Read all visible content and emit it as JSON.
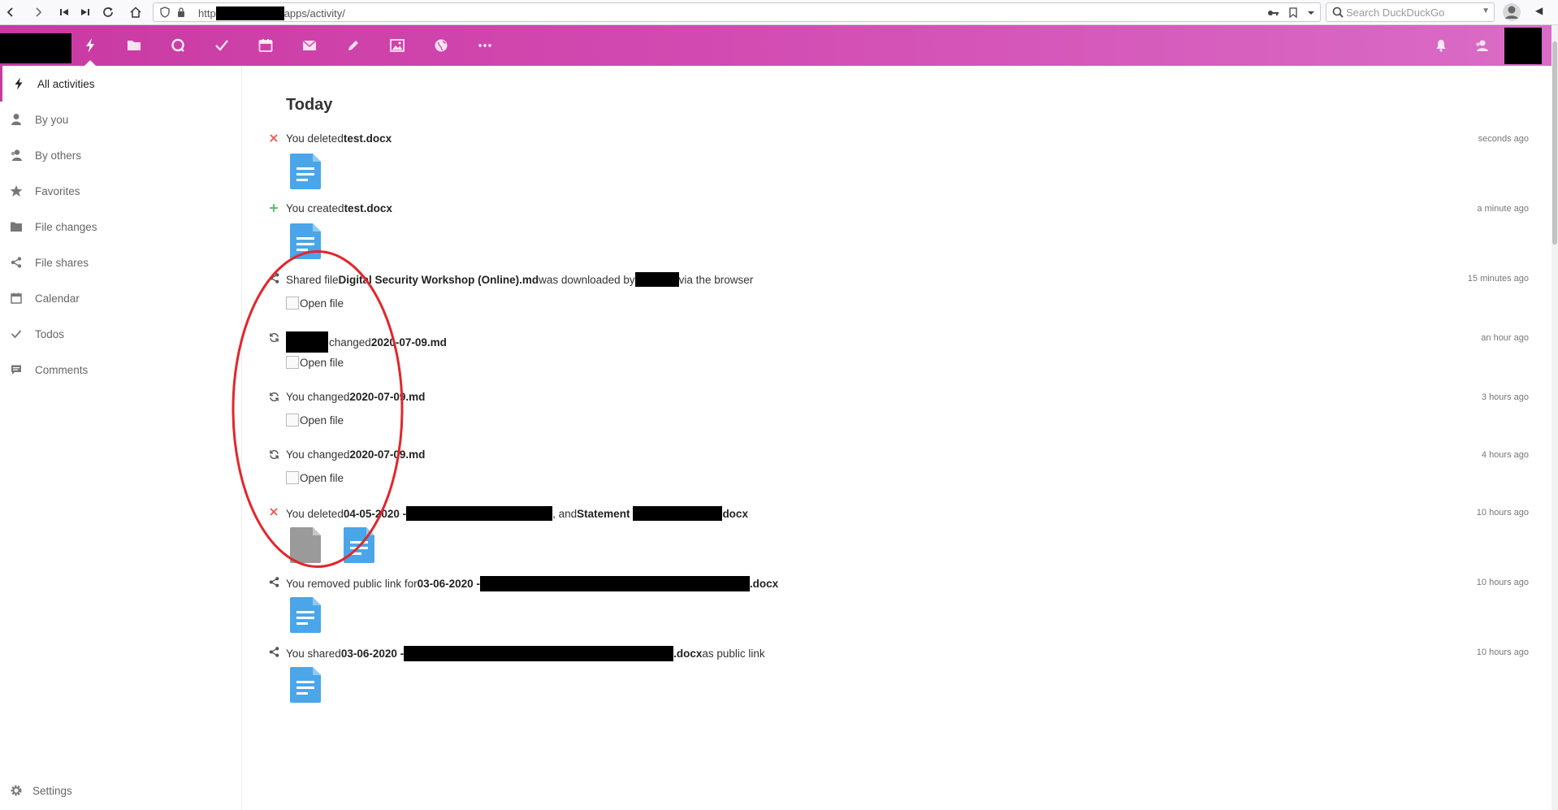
{
  "browser": {
    "url_prefix": "http",
    "url_suffix": "apps/activity/",
    "search_placeholder": "Search DuckDuckGo"
  },
  "header": {
    "apps": [
      {
        "name": "activity",
        "icon": "bolt-icon",
        "active": true
      },
      {
        "name": "files",
        "icon": "folder-icon"
      },
      {
        "name": "talk",
        "icon": "talk-icon"
      },
      {
        "name": "tasks",
        "icon": "check-icon"
      },
      {
        "name": "calendar",
        "icon": "calendar-icon"
      },
      {
        "name": "mail",
        "icon": "mail-icon"
      },
      {
        "name": "notes",
        "icon": "pencil-icon"
      },
      {
        "name": "photos",
        "icon": "image-icon"
      },
      {
        "name": "maps",
        "icon": "globe-icon"
      },
      {
        "name": "more",
        "icon": "more-icon"
      }
    ]
  },
  "sidebar": {
    "items": [
      {
        "label": "All activities",
        "icon": "bolt-icon",
        "active": true
      },
      {
        "label": "By you",
        "icon": "user-icon"
      },
      {
        "label": "By others",
        "icon": "users-icon"
      },
      {
        "label": "Favorites",
        "icon": "star-icon"
      },
      {
        "label": "File changes",
        "icon": "folder-icon"
      },
      {
        "label": "File shares",
        "icon": "share-icon"
      },
      {
        "label": "Calendar",
        "icon": "calendar-icon"
      },
      {
        "label": "Todos",
        "icon": "check-icon"
      },
      {
        "label": "Comments",
        "icon": "comment-icon"
      }
    ],
    "settings_label": "Settings"
  },
  "stream": {
    "section_title": "Today",
    "activities": [
      {
        "icon": "delete-x-icon",
        "parts": [
          "You deleted ",
          "test.docx"
        ],
        "time": "seconds ago"
      },
      {
        "icon": "add-plus-icon",
        "parts": [
          "You created ",
          "test.docx"
        ],
        "time": "a minute ago"
      },
      {
        "icon": "share-icon",
        "parts": [
          "Shared file ",
          "Digital Security Workshop (Online).md",
          " was downloaded by",
          "via the browser"
        ],
        "time": "15 minutes ago",
        "preview_alt": "Open file"
      },
      {
        "icon": "change-icon",
        "parts": [
          "changed ",
          "2020-07-09.md"
        ],
        "time": "an hour ago",
        "preview_alt": "Open file"
      },
      {
        "icon": "change-icon",
        "parts": [
          "You changed ",
          "2020-07-09.md"
        ],
        "time": "3 hours ago",
        "preview_alt": "Open file"
      },
      {
        "icon": "change-icon",
        "parts": [
          "You changed ",
          "2020-07-09.md"
        ],
        "time": "4 hours ago",
        "preview_alt": "Open file"
      },
      {
        "icon": "delete-x-icon",
        "parts": [
          "You deleted ",
          "04-05-2020 - ",
          ", and ",
          "Statement ",
          "docx"
        ],
        "time": "10 hours ago"
      },
      {
        "icon": "share-icon",
        "parts": [
          "You removed public link for ",
          "03-06-2020 - ",
          ".docx"
        ],
        "time": "10 hours ago"
      },
      {
        "icon": "share-icon",
        "parts": [
          "You shared ",
          "03-06-2020 - ",
          ".docx",
          " as public link"
        ],
        "time": "10 hours ago"
      }
    ]
  },
  "colors": {
    "header_start": "#c93aa2",
    "header_end": "#da6cc6",
    "file_icon": "#4aa6e8",
    "deleted_x": "#e8524a",
    "created_plus": "#46ba61",
    "annotation": "#e2262b"
  }
}
